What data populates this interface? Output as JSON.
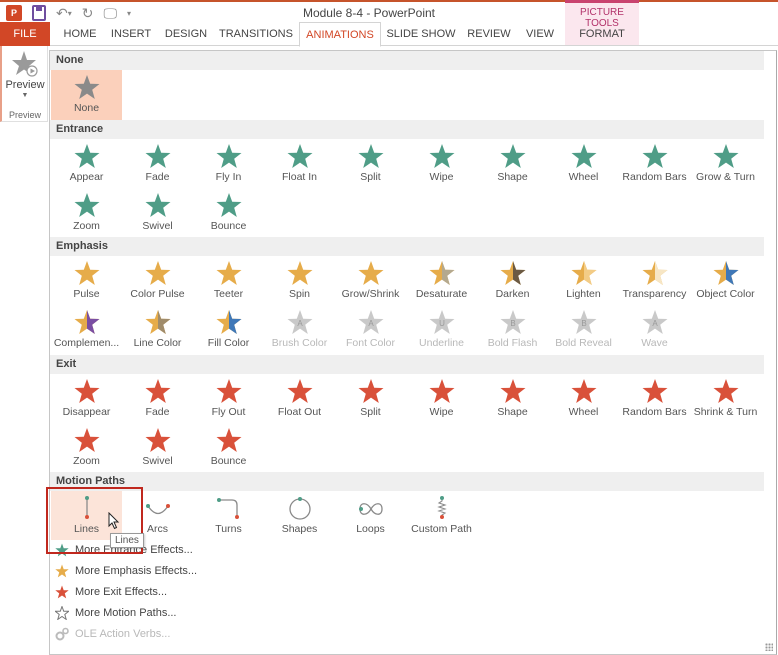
{
  "window": {
    "title": "Module 8-4 - PowerPoint",
    "contextual_group": "PICTURE TOOLS"
  },
  "quick_access": {
    "app_icon": "powerpoint-icon",
    "save_icon": "save-icon",
    "undo_icon": "undo-icon",
    "redo_icon": "redo-icon",
    "present_icon": "start-from-beginning-icon",
    "customize_icon": "customize-qat-icon"
  },
  "tabs": [
    {
      "label": "FILE"
    },
    {
      "label": "HOME"
    },
    {
      "label": "INSERT"
    },
    {
      "label": "DESIGN"
    },
    {
      "label": "TRANSITIONS"
    },
    {
      "label": "ANIMATIONS",
      "active": true
    },
    {
      "label": "SLIDE SHOW"
    },
    {
      "label": "REVIEW"
    },
    {
      "label": "VIEW"
    },
    {
      "label": "FORMAT"
    }
  ],
  "preview_group": {
    "button_label": "Preview",
    "group_label": "Preview"
  },
  "colors": {
    "accent": "#d24726",
    "entrance": "#4f9d87",
    "emphasis": "#e6ac4a",
    "exit": "#d9513a",
    "none": "#8a8a8a",
    "selected_bg": "#fbd0bb",
    "focus_box": "#c0281e"
  },
  "gallery": {
    "sections": [
      {
        "title": "None",
        "items": [
          {
            "label": "None",
            "selected": true
          }
        ]
      },
      {
        "title": "Entrance",
        "items": [
          {
            "label": "Appear"
          },
          {
            "label": "Fade"
          },
          {
            "label": "Fly In"
          },
          {
            "label": "Float In"
          },
          {
            "label": "Split"
          },
          {
            "label": "Wipe"
          },
          {
            "label": "Shape"
          },
          {
            "label": "Wheel"
          },
          {
            "label": "Random Bars"
          },
          {
            "label": "Grow & Turn"
          },
          {
            "label": "Zoom"
          },
          {
            "label": "Swivel"
          },
          {
            "label": "Bounce"
          }
        ]
      },
      {
        "title": "Emphasis",
        "items": [
          {
            "label": "Pulse"
          },
          {
            "label": "Color Pulse"
          },
          {
            "label": "Teeter"
          },
          {
            "label": "Spin"
          },
          {
            "label": "Grow/Shrink"
          },
          {
            "label": "Desaturate"
          },
          {
            "label": "Darken"
          },
          {
            "label": "Lighten"
          },
          {
            "label": "Transparency"
          },
          {
            "label": "Object Color"
          },
          {
            "label": "Complemen..."
          },
          {
            "label": "Line Color"
          },
          {
            "label": "Fill Color"
          },
          {
            "label": "Brush Color",
            "disabled": true
          },
          {
            "label": "Font Color",
            "disabled": true
          },
          {
            "label": "Underline",
            "disabled": true
          },
          {
            "label": "Bold Flash",
            "disabled": true
          },
          {
            "label": "Bold Reveal",
            "disabled": true
          },
          {
            "label": "Wave",
            "disabled": true
          }
        ]
      },
      {
        "title": "Exit",
        "items": [
          {
            "label": "Disappear"
          },
          {
            "label": "Fade"
          },
          {
            "label": "Fly Out"
          },
          {
            "label": "Float Out"
          },
          {
            "label": "Split"
          },
          {
            "label": "Wipe"
          },
          {
            "label": "Shape"
          },
          {
            "label": "Wheel"
          },
          {
            "label": "Random Bars"
          },
          {
            "label": "Shrink & Turn"
          },
          {
            "label": "Zoom"
          },
          {
            "label": "Swivel"
          },
          {
            "label": "Bounce"
          }
        ]
      },
      {
        "title": "Motion Paths",
        "items": [
          {
            "label": "Lines",
            "hover": true
          },
          {
            "label": "Arcs"
          },
          {
            "label": "Turns"
          },
          {
            "label": "Shapes"
          },
          {
            "label": "Loops"
          },
          {
            "label": "Custom Path"
          }
        ]
      }
    ],
    "tooltip": "Lines",
    "more": [
      {
        "label": "More Entrance Effects...",
        "icon": "entrance-star-icon"
      },
      {
        "label": "More Emphasis Effects...",
        "icon": "emphasis-star-icon"
      },
      {
        "label": "More Exit Effects...",
        "icon": "exit-star-icon"
      },
      {
        "label": "More Motion Paths...",
        "icon": "motion-path-star-icon"
      },
      {
        "label": "OLE Action Verbs...",
        "icon": "gears-icon",
        "disabled": true
      }
    ]
  }
}
